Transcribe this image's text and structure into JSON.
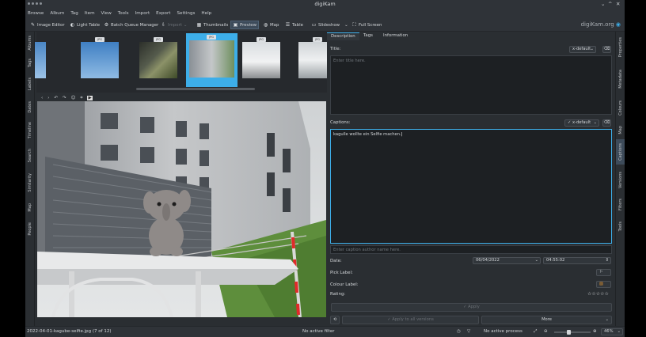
{
  "window": {
    "title": "digiKam",
    "minimize": "⌄",
    "maximize": "^",
    "close": "✕"
  },
  "menu": [
    "Browse",
    "Album",
    "Tag",
    "Item",
    "View",
    "Tools",
    "Import",
    "Export",
    "Settings",
    "Help"
  ],
  "toolbar": {
    "image_editor": "Image Editor",
    "light_table": "Light Table",
    "batch_queue": "Batch Queue Manager",
    "import": "Import",
    "thumbnails": "Thumbnails",
    "preview": "Preview",
    "map": "Map",
    "table": "Table",
    "slideshow": "Slideshow",
    "fullscreen": "Full Screen",
    "brand": "digiKam.org"
  },
  "left_sidebar": [
    "Albums",
    "Tags",
    "Labels",
    "Dates",
    "Timeline",
    "Search",
    "Similarity",
    "Map",
    "People"
  ],
  "right_sidebar": [
    "Properties",
    "Metadata",
    "Colours",
    "Map",
    "Captions",
    "Versions",
    "Filters",
    "Tools"
  ],
  "thumbs": [
    {
      "badge": "JPG"
    },
    {
      "badge": "JPG"
    },
    {
      "badge": "JPG"
    },
    {
      "badge": "JPG"
    },
    {
      "badge": "JPG"
    }
  ],
  "captions": {
    "tabs": [
      "Description",
      "Tags",
      "Information"
    ],
    "title_label": "Title:",
    "title_lang": "x-default",
    "title_placeholder": "Enter title here.",
    "captions_label": "Captions:",
    "captions_lang": "x-default",
    "caption_value": "kagulle wollte ein Selfie machen.",
    "author_placeholder": "Enter caption author name here.",
    "date_label": "Date:",
    "date_value": "06/04/2022",
    "time_value": "04:55:02",
    "pick_label": "Pick Label:",
    "colour_label": "Colour Label:",
    "rating_label": "Rating:",
    "rating_stars": "☆☆☆☆☆",
    "apply": "Apply",
    "apply_all": "Apply to all versions",
    "more": "More"
  },
  "statusbar": {
    "file": "2022-04-01-kagube-selfie.jpg (7 of 12)",
    "filter": "No active filter",
    "process": "No active process",
    "zoom": "46%"
  },
  "colors": {
    "accent": "#3daee9",
    "window_bg": "#2a2e32",
    "toolbar_bg": "#2f3338"
  }
}
